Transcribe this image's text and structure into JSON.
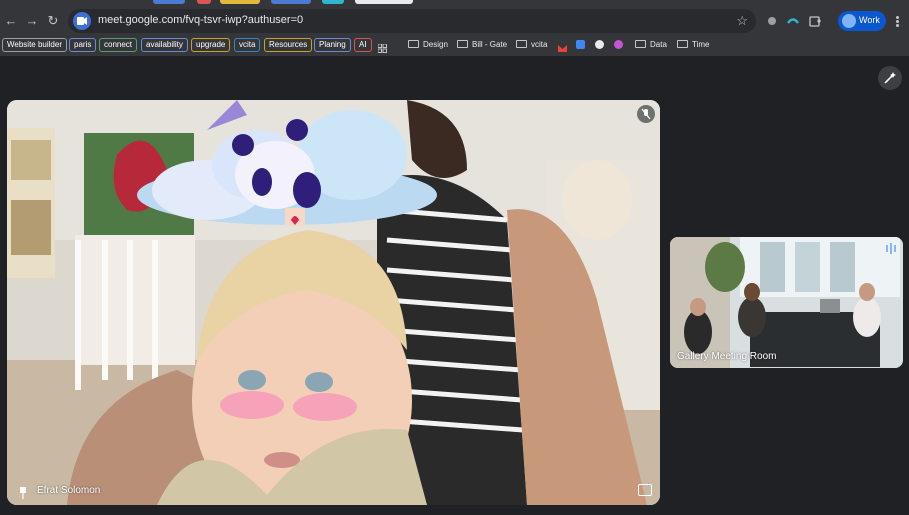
{
  "browser": {
    "url": "meet.google.com/fvq-tsvr-iwp?authuser=0",
    "profile_label": "Work",
    "bookmarks_chips": [
      {
        "label": "Website builder",
        "color": "#5f6368"
      },
      {
        "label": "paris",
        "color": "#6b8bd6"
      },
      {
        "label": "connect",
        "color": "#5a9e6f"
      },
      {
        "label": "availability",
        "color": "#6b8bd6"
      },
      {
        "label": "upgrade",
        "color": "#c9a227"
      },
      {
        "label": "vcita",
        "color": "#3b82c4"
      },
      {
        "label": "Resources",
        "color": "#c9a227"
      },
      {
        "label": "Planing",
        "color": "#6b8bd6"
      },
      {
        "label": "AI",
        "color": "#d9534f"
      }
    ],
    "bookmarks_folders": [
      "Design",
      "Bill - Gate",
      "vcita",
      "Data",
      "Time"
    ]
  },
  "meet": {
    "main_participant": "Efrat Solomon",
    "side_participant": "Gallery Meeting Room"
  },
  "colors": {
    "accent_blue": "#0b57d0",
    "speaking_blue": "#1a73e8",
    "background": "#202124"
  }
}
